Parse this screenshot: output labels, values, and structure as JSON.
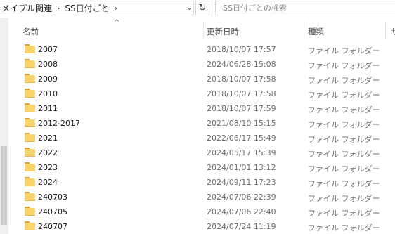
{
  "address": {
    "breadcrumbs": [
      "メイプル関連",
      "SS日付ごと"
    ],
    "separator": "›"
  },
  "search": {
    "placeholder": "SS日付ごとの検索"
  },
  "columns": {
    "name": "名前",
    "date": "更新日時",
    "type": "種類",
    "size": "サ"
  },
  "rows": [
    {
      "name": "2007",
      "date": "2018/10/07 17:57",
      "type": "ファイル フォルダー"
    },
    {
      "name": "2008",
      "date": "2024/06/28 15:08",
      "type": "ファイル フォルダー"
    },
    {
      "name": "2009",
      "date": "2018/10/07 17:58",
      "type": "ファイル フォルダー"
    },
    {
      "name": "2010",
      "date": "2018/10/07 17:58",
      "type": "ファイル フォルダー"
    },
    {
      "name": "2011",
      "date": "2018/10/07 17:59",
      "type": "ファイル フォルダー"
    },
    {
      "name": "2012-2017",
      "date": "2021/08/10 15:15",
      "type": "ファイル フォルダー"
    },
    {
      "name": "2021",
      "date": "2022/06/17 15:49",
      "type": "ファイル フォルダー"
    },
    {
      "name": "2022",
      "date": "2024/05/17 15:39",
      "type": "ファイル フォルダー"
    },
    {
      "name": "2023",
      "date": "2024/01/01 13:12",
      "type": "ファイル フォルダー"
    },
    {
      "name": "2024",
      "date": "2024/09/11 17:23",
      "type": "ファイル フォルダー"
    },
    {
      "name": "240703",
      "date": "2024/07/06 22:39",
      "type": "ファイル フォルダー"
    },
    {
      "name": "240705",
      "date": "2024/07/06 22:40",
      "type": "ファイル フォルダー"
    },
    {
      "name": "240707",
      "date": "2024/07/24 11:19",
      "type": "ファイル フォルダー"
    }
  ]
}
